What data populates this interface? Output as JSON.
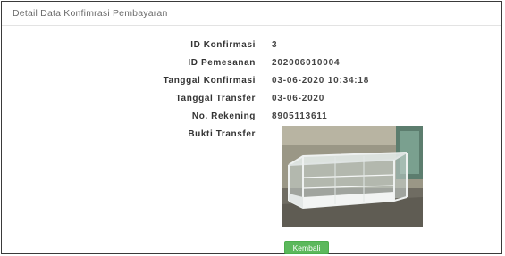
{
  "panel": {
    "title": "Detail Data Konfimrasi Pembayaran"
  },
  "details": [
    {
      "label": "ID Konfirmasi",
      "value": "3"
    },
    {
      "label": "ID Pemesanan",
      "value": "202006010004"
    },
    {
      "label": "Tanggal Konfirmasi",
      "value": "03-06-2020 10:34:18"
    },
    {
      "label": "Tanggal Transfer",
      "value": "03-06-2020"
    },
    {
      "label": "No. Rekening",
      "value": "8905113611"
    }
  ],
  "proof": {
    "label": "Bukti Transfer"
  },
  "actions": {
    "back_label": "Kembali"
  }
}
